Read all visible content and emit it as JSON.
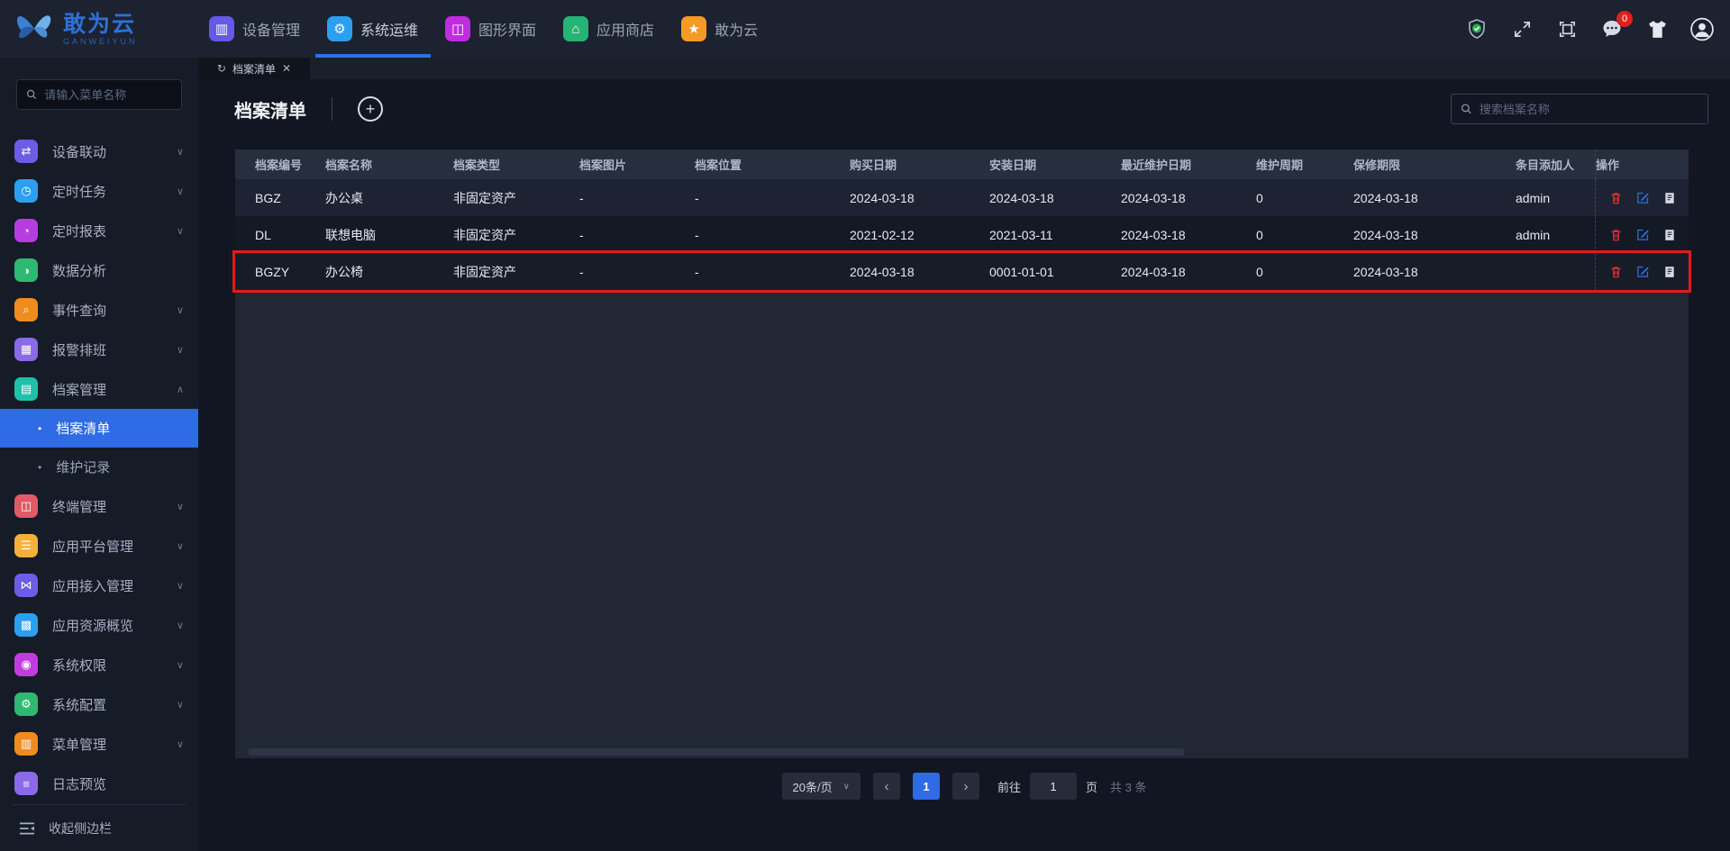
{
  "colors": {
    "accent": "#2e6be4",
    "underline": "#2f6fe4",
    "highlight_red": "#e01b1b",
    "danger": "#e03131",
    "badge_red": "#e02020"
  },
  "topbar": {
    "logo": {
      "title": "敢为云",
      "subtitle": "GANWEIYUN"
    },
    "tabs": [
      {
        "label": "设备管理",
        "glyph": "▥",
        "color": "#6658e8"
      },
      {
        "label": "系统运维",
        "glyph": "⚙",
        "color": "#2d9ff0"
      },
      {
        "label": "图形界面",
        "glyph": "◫",
        "color": "#c02ce0"
      },
      {
        "label": "应用商店",
        "glyph": "⌂",
        "color": "#27b376"
      },
      {
        "label": "敢为云",
        "glyph": "★",
        "color": "#f59a23"
      }
    ],
    "badge_count": "0"
  },
  "sidebar": {
    "search_placeholder": "请输入菜单名称",
    "items": [
      {
        "label": "设备联动",
        "glyph": "⇄",
        "color": "#6c5ce7",
        "chevron": "∨"
      },
      {
        "label": "定时任务",
        "glyph": "◷",
        "color": "#2d9ff0",
        "chevron": "∨"
      },
      {
        "label": "定时报表",
        "glyph": "◔",
        "color": "#b63ce0",
        "chevron": "∨"
      },
      {
        "label": "数据分析",
        "glyph": "◑",
        "color": "#2eb872",
        "chevron": ""
      },
      {
        "label": "事件查询",
        "glyph": "⌕",
        "color": "#f08c1e",
        "chevron": "∨"
      },
      {
        "label": "报警排班",
        "glyph": "▦",
        "color": "#8a6ae8",
        "chevron": "∨"
      },
      {
        "label": "档案管理",
        "glyph": "▤",
        "color": "#1fc0a8",
        "chevron": "∧"
      },
      {
        "label": "终端管理",
        "glyph": "◫",
        "color": "#e05a68",
        "chevron": "∨"
      },
      {
        "label": "应用平台管理",
        "glyph": "☰",
        "color": "#f5b03c",
        "chevron": "∨"
      },
      {
        "label": "应用接入管理",
        "glyph": "⋈",
        "color": "#6c5ce7",
        "chevron": "∨"
      },
      {
        "label": "应用资源概览",
        "glyph": "▩",
        "color": "#2d9ff0",
        "chevron": "∨"
      },
      {
        "label": "系统权限",
        "glyph": "◉",
        "color": "#c13ce0",
        "chevron": "∨"
      },
      {
        "label": "系统配置",
        "glyph": "⚙",
        "color": "#2eb872",
        "chevron": "∨"
      },
      {
        "label": "菜单管理",
        "glyph": "▥",
        "color": "#f08c1e",
        "chevron": "∨"
      },
      {
        "label": "日志预览",
        "glyph": "≡",
        "color": "#8a6ae8",
        "chevron": ""
      }
    ],
    "submenu": [
      {
        "label": "档案清单",
        "bullet": "•",
        "active": true
      },
      {
        "label": "维护记录",
        "bullet": "•",
        "active": false
      }
    ],
    "collapse_label": "收起侧边栏"
  },
  "tabstrip": {
    "active_tab": "档案清单",
    "refresh_glyph": "↻",
    "close_glyph": "✕"
  },
  "main": {
    "title": "档案清单",
    "add_glyph": "+",
    "search_placeholder": "搜索档案名称",
    "table": {
      "columns": [
        "档案编号",
        "档案名称",
        "档案类型",
        "档案图片",
        "档案位置",
        "购买日期",
        "安装日期",
        "最近维护日期",
        "维护周期",
        "保修期限",
        "条目添加人",
        "操作"
      ],
      "rows": [
        {
          "cells": [
            "BGZ",
            "办公桌",
            "非固定资产",
            "-",
            "-",
            "2024-03-18",
            "2024-03-18",
            "2024-03-18",
            "0",
            "2024-03-18",
            "admin"
          ],
          "highlighted": false
        },
        {
          "cells": [
            "DL",
            "联想电脑",
            "非固定资产",
            "-",
            "-",
            "2021-02-12",
            "2021-03-11",
            "2024-03-18",
            "0",
            "2024-03-18",
            "admin"
          ],
          "highlighted": false
        },
        {
          "cells": [
            "BGZY",
            "办公椅",
            "非固定资产",
            "-",
            "-",
            "2024-03-18",
            "0001-01-01",
            "2024-03-18",
            "0",
            "2024-03-18",
            ""
          ],
          "highlighted": true
        }
      ]
    },
    "pagination": {
      "page_size": "20条/页",
      "prev_glyph": "‹",
      "next_glyph": "›",
      "current_page": "1",
      "goto_label": "前往",
      "goto_value": "1",
      "page_label": "页",
      "total_label": "共 3 条"
    }
  }
}
